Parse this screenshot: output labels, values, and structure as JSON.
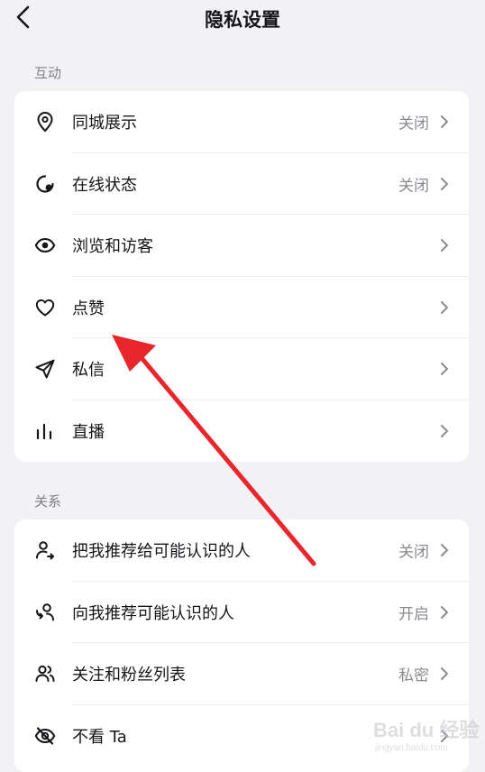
{
  "header": {
    "title": "隐私设置"
  },
  "sections": [
    {
      "label": "互动",
      "items": [
        {
          "label": "同城展示",
          "value": "关闭",
          "icon": "location-pin-icon"
        },
        {
          "label": "在线状态",
          "value": "关闭",
          "icon": "online-status-icon"
        },
        {
          "label": "浏览和访客",
          "value": "",
          "icon": "eye-icon"
        },
        {
          "label": "点赞",
          "value": "",
          "icon": "heart-icon"
        },
        {
          "label": "私信",
          "value": "",
          "icon": "paper-plane-icon"
        },
        {
          "label": "直播",
          "value": "",
          "icon": "bar-chart-icon"
        }
      ]
    },
    {
      "label": "关系",
      "items": [
        {
          "label": "把我推荐给可能认识的人",
          "value": "关闭",
          "icon": "user-share-icon"
        },
        {
          "label": "向我推荐可能认识的人",
          "value": "开启",
          "icon": "user-recommend-icon"
        },
        {
          "label": "关注和粉丝列表",
          "value": "私密",
          "icon": "users-icon"
        },
        {
          "label": "不看 Ta",
          "value": "",
          "icon": "eye-off-icon"
        }
      ]
    }
  ],
  "annotation": {
    "color": "#e8262b",
    "icon": "red-arrow-annotation"
  },
  "watermark": {
    "text": "Bai du 经验",
    "sub": "jingyan.baidu.com"
  }
}
